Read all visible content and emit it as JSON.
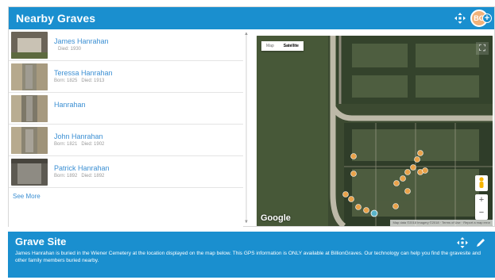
{
  "nearby": {
    "title": "Nearby Graves",
    "avatar_initials": "BG",
    "see_more": "See More",
    "graves": [
      {
        "name": "James Hanrahan",
        "born": "",
        "died": "Died: 1930"
      },
      {
        "name": "Teressa Hanrahan",
        "born": "Born: 1825",
        "died": "Died: 1913"
      },
      {
        "name": "Hanrahan",
        "born": "",
        "died": ""
      },
      {
        "name": "John Hanrahan",
        "born": "Born: 1821",
        "died": "Died: 1902"
      },
      {
        "name": "Patrick Hanrahan",
        "born": "Born: 1892",
        "died": "Died: 1892"
      }
    ]
  },
  "map": {
    "toggle_map": "Map",
    "toggle_satellite": "Satellite",
    "logo": "Google",
    "attribution": "Map data ©2018 Imagery ©2018 · Terms of Use · Report a map error"
  },
  "grave_site": {
    "title": "Grave Site",
    "description": "James Hanrahan is buried in the Wiener Cemetery at the location displayed on the map below. This GPS information is ONLY available at BillionGraves. Our technology can help you find the gravesite and other family members buried nearby."
  },
  "colors": {
    "accent": "#1a8fcf",
    "link": "#3b8fd3",
    "marker": "#e9a24a"
  },
  "icons": [
    "move-icon",
    "avatar",
    "plus-icon",
    "fullscreen-icon",
    "pegman-icon",
    "pencil-icon"
  ]
}
